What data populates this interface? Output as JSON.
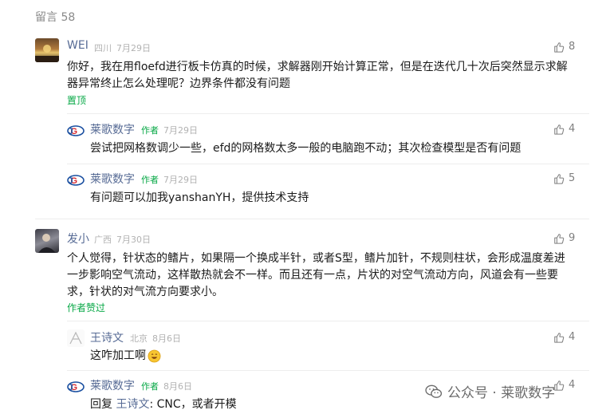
{
  "header": {
    "title": "留言 58"
  },
  "comments": [
    {
      "name": "WEI",
      "location": "四川",
      "date": "7月29日",
      "likes": "8",
      "text": "你好，我在用floefd进行板卡仿真的时候，求解器刚开始计算正常，但是在迭代几十次后突然显示求解器异常终止怎么处理呢？边界条件都没有问题",
      "tag": "置顶",
      "replies": [
        {
          "name": "莱歌数字",
          "author": "作者",
          "date": "7月29日",
          "likes": "4",
          "text": "尝试把网格数调少一些，efd的网格数太多一般的电脑跑不动；其次检查模型是否有问题"
        },
        {
          "name": "莱歌数字",
          "author": "作者",
          "date": "7月29日",
          "likes": "5",
          "text": "有问题可以加我yanshanYH，提供技术支持"
        }
      ]
    },
    {
      "name": "发小",
      "location": "广西",
      "date": "7月30日",
      "likes": "9",
      "text": "个人觉得，针状态的鳍片，如果隔一个换成半针，或者S型，鳍片加针，不规则柱状，会形成温度差进一步影响空气流动，这样散热就会不一样。而且还有一点，片状的对空气流动方向，风道会有一些要求，针状的对气流方向要求小。",
      "tag": "作者赞过",
      "replies": [
        {
          "name": "王诗文",
          "location": "北京",
          "date": "8月6日",
          "likes": "4",
          "text": "这咋加工啊"
        },
        {
          "name": "莱歌数字",
          "author": "作者",
          "date": "8月6日",
          "likes": "4",
          "text_prefix": "回复",
          "reply_to": "王诗文",
          "text": ": CNC，或者开模"
        }
      ]
    }
  ],
  "watermark": {
    "text": "公众号 · 莱歌数字"
  },
  "icons": {
    "like": "thumbs-up-icon",
    "emoji": "grin-emoji-icon",
    "watermark": "wechat-icon"
  },
  "colors": {
    "link": "#576b95",
    "author": "#07a846",
    "meta": "#b2b2b2"
  }
}
